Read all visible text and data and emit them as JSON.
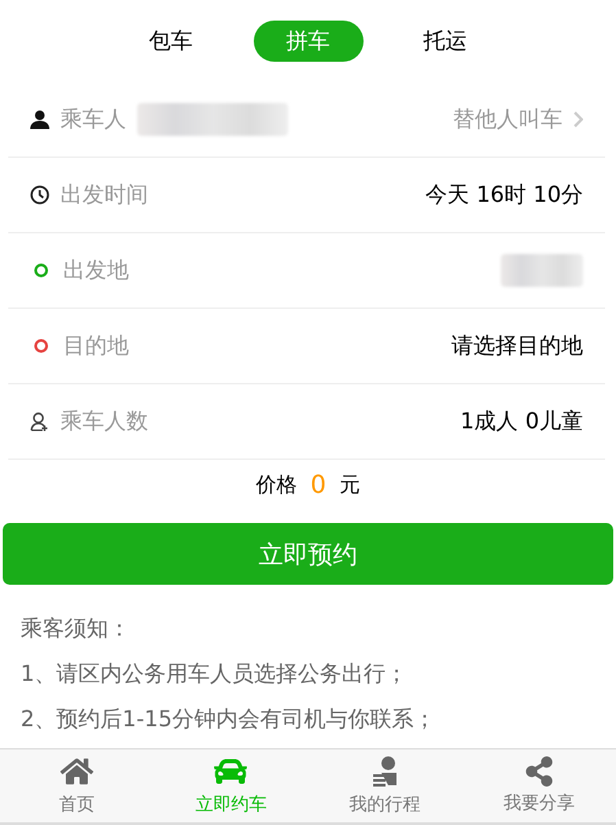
{
  "tabs": [
    {
      "label": "包车",
      "selected": false
    },
    {
      "label": "拼车",
      "selected": true
    },
    {
      "label": "托运",
      "selected": false
    }
  ],
  "rows": [
    {
      "kind": "passenger",
      "label": "乘车人",
      "value": "替他人叫车"
    },
    {
      "kind": "time",
      "label": "出发时间",
      "value": "今天 16时 10分"
    },
    {
      "kind": "origin",
      "label": "出发地",
      "color": "#1aad19"
    },
    {
      "kind": "destination",
      "label": "目的地",
      "value": "请选择目的地",
      "color": "#e64340"
    },
    {
      "kind": "count",
      "label": "乘车人数",
      "value": "1成人 0儿童"
    }
  ],
  "price": {
    "label": "价格",
    "amount": "0",
    "unit": "元"
  },
  "submit_button": "立即预约",
  "notice": {
    "title": "乘客须知：",
    "lines": [
      "1、请区内公务用车人员选择公务出行；",
      "2、预约后1-15分钟内会有司机与你联系；"
    ]
  },
  "nav": [
    {
      "kind": "home",
      "label": "首页",
      "selected": false
    },
    {
      "kind": "car",
      "label": "立即约车",
      "selected": true
    },
    {
      "kind": "trips",
      "label": "我的行程",
      "selected": false
    },
    {
      "kind": "share",
      "label": "我要分享",
      "selected": false
    }
  ]
}
